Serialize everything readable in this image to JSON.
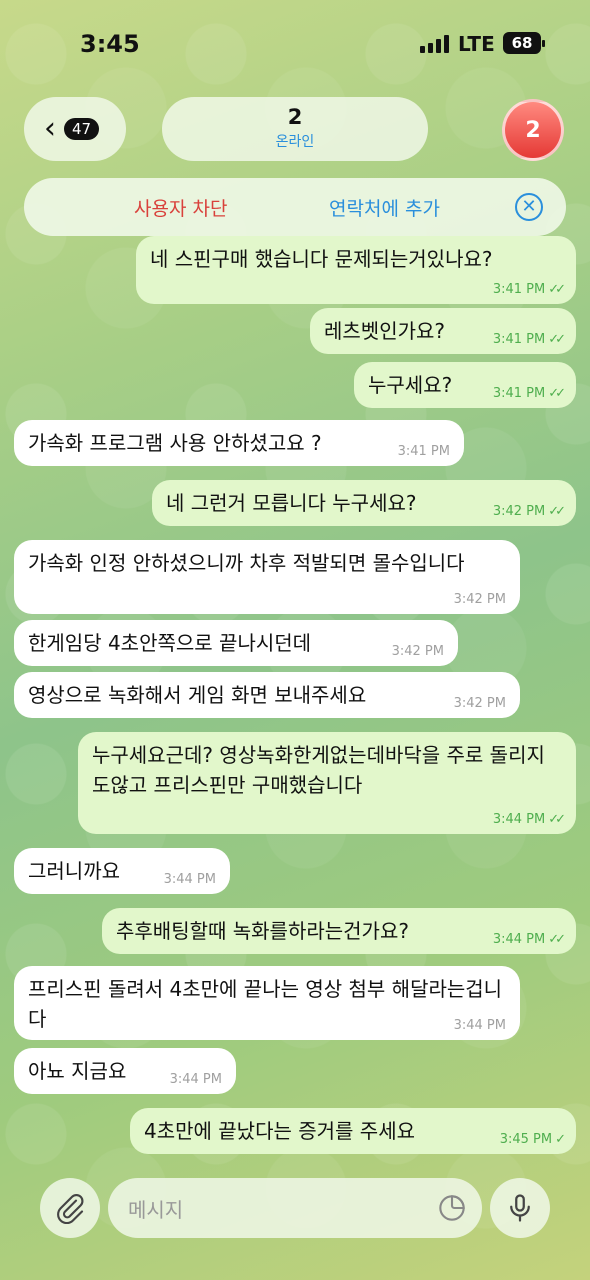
{
  "status_bar": {
    "time": "3:45",
    "network": "LTE",
    "battery": "68"
  },
  "header": {
    "unread_count": "47",
    "chat_name": "2",
    "chat_status": "온라인",
    "avatar_initial": "2"
  },
  "action_bar": {
    "block_label": "사용자 차단",
    "add_contact_label": "연락처에 추가"
  },
  "messages": [
    {
      "dir": "out",
      "text": "네 스핀구매 했습니다 문제되는거있나요?",
      "time": "3:41 PM",
      "check": "✓✓"
    },
    {
      "dir": "out",
      "text": "레츠벳인가요?",
      "time": "3:41 PM",
      "check": "✓✓"
    },
    {
      "dir": "out",
      "text": "누구세요?",
      "time": "3:41 PM",
      "check": "✓✓"
    },
    {
      "dir": "in",
      "text": "가속화 프로그램 사용 안하셨고요 ?",
      "time": "3:41 PM"
    },
    {
      "dir": "out",
      "text": "네 그런거 모릅니다 누구세요?",
      "time": "3:42 PM",
      "check": "✓✓"
    },
    {
      "dir": "in",
      "text": "가속화 인정 안하셨으니까 차후 적발되면 몰수입니다",
      "time": "3:42 PM"
    },
    {
      "dir": "in",
      "text": "한게임당 4초안쪽으로 끝나시던데",
      "time": "3:42 PM"
    },
    {
      "dir": "in",
      "text": "영상으로 녹화해서 게임 화면 보내주세요",
      "time": "3:42 PM"
    },
    {
      "dir": "out",
      "text": "누구세요근데? 영상녹화한게없는데바닥을 주로 돌리지도않고 프리스핀만 구매했습니다",
      "time": "3:44 PM",
      "check": "✓✓"
    },
    {
      "dir": "in",
      "text": "그러니까요",
      "time": "3:44 PM"
    },
    {
      "dir": "out",
      "text": "추후배팅할때 녹화를하라는건가요?",
      "time": "3:44 PM",
      "check": "✓✓"
    },
    {
      "dir": "in",
      "text": "프리스핀 돌려서 4초만에 끝나는 영상 첨부 해달라는겁니다",
      "time": "3:44 PM"
    },
    {
      "dir": "in",
      "text": "아뇨 지금요",
      "time": "3:44 PM"
    },
    {
      "dir": "out",
      "text": "4초만에 끝났다는 증거를 주세요",
      "time": "3:45 PM",
      "check": "✓"
    }
  ],
  "composer": {
    "placeholder": "메시지"
  },
  "icons": [
    "back-chevron-icon",
    "close-circle-icon",
    "paperclip-icon",
    "sticker-icon",
    "microphone-icon"
  ],
  "colors": {
    "outgoing_bubble": "#e2f7cb",
    "incoming_bubble": "#ffffff",
    "accent_blue": "#2a8fdc",
    "block_red": "#d9413b",
    "avatar_red": "#e53935"
  }
}
